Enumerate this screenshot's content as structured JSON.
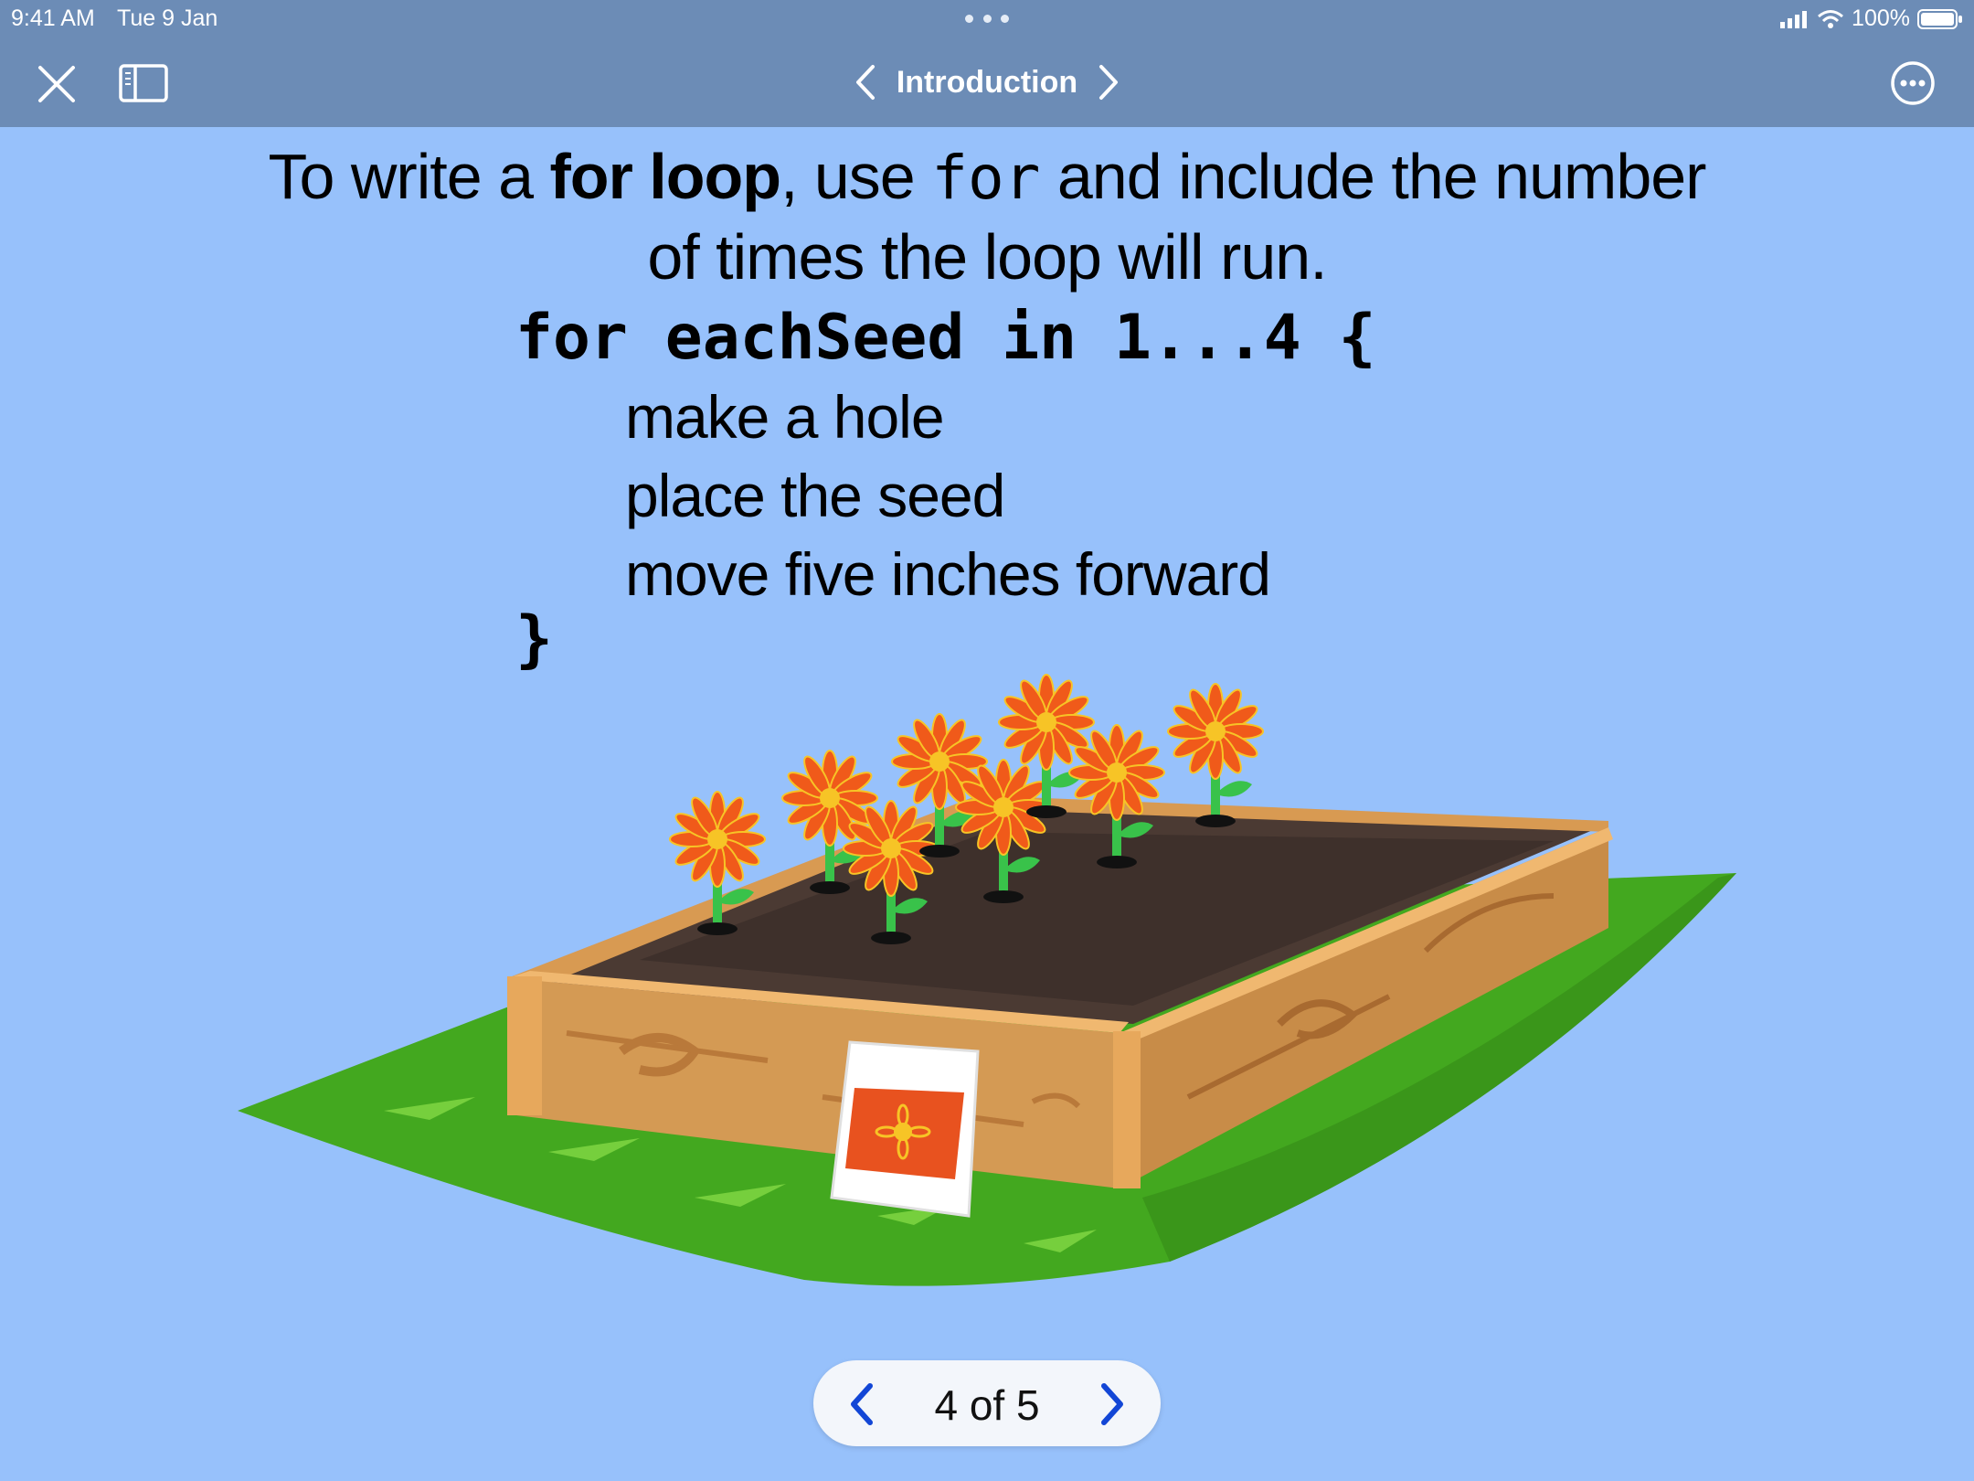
{
  "status_bar": {
    "time": "9:41 AM",
    "date": "Tue 9 Jan",
    "battery": "100%"
  },
  "nav": {
    "title": "Introduction"
  },
  "intro": {
    "part1": "To write a ",
    "bold": "for loop",
    "part2": ", use ",
    "code": "for",
    "part3": " and include the number of times the loop will run."
  },
  "code_block": {
    "header": "for eachSeed in 1...4 {",
    "steps": [
      "make a hole",
      "place the seed",
      "move five inches forward"
    ],
    "closing": "}"
  },
  "pager": {
    "label": "4 of 5"
  },
  "colors": {
    "background": "#97c1fb",
    "topbar": "#6c8cb6",
    "accent": "#1246d6"
  }
}
